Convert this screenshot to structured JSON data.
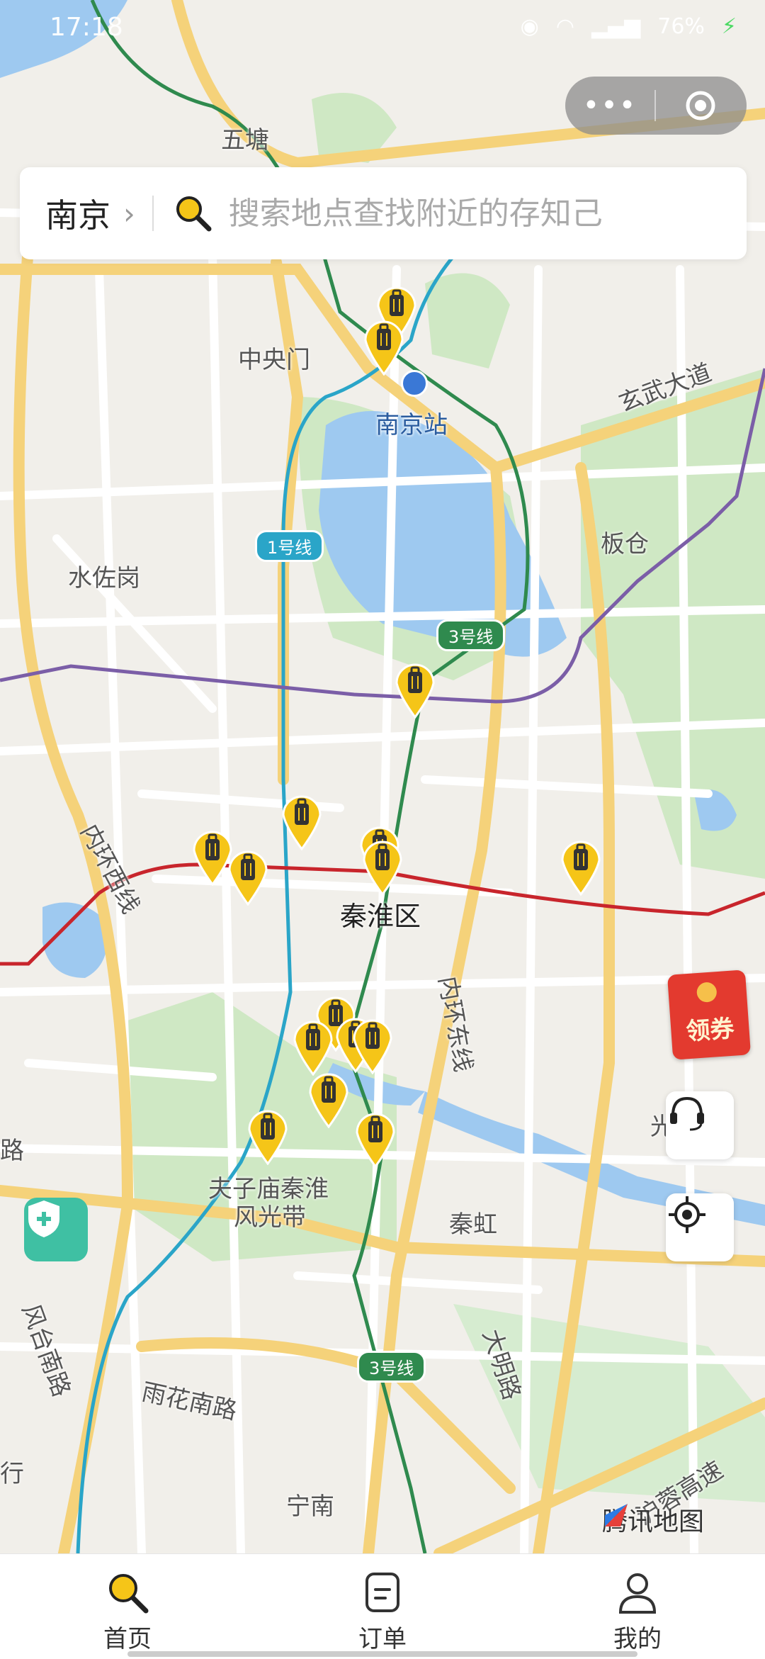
{
  "status_bar": {
    "time": "17:18",
    "battery": "76%"
  },
  "search": {
    "city": "南京",
    "placeholder": "搜索地点查找附近的存知己"
  },
  "map_labels": {
    "wutang": "五塘",
    "zhongyangmen": "中央门",
    "nanjing_station": "南京站",
    "xuanwu_avenue": "玄武大道",
    "bancang": "板仓",
    "shuizuogang": "水佐岗",
    "inner_ring_west": "内环西线",
    "qinhuai_district": "秦淮区",
    "inner_ring_east": "内环东线",
    "fuzimiao": "夫子庙秦淮",
    "fuzimiao2": "风光带",
    "qinhong": "秦虹",
    "daming_road": "大明路",
    "yuhua_south_road": "雨花南路",
    "ningnan": "宁南",
    "hunan_expressway": "沪蓉高速",
    "fengtai_south": "风台南路",
    "guang": "光",
    "lu": "路",
    "xing": "行"
  },
  "line_badges": {
    "line1": "1号线",
    "line3_top": "3号线",
    "line3_bottom": "3号线"
  },
  "coupon": {
    "label": "领券"
  },
  "map_brand": "腾讯地图",
  "tabs": [
    {
      "label": "首页",
      "icon": "search-icon"
    },
    {
      "label": "订单",
      "icon": "order-icon"
    },
    {
      "label": "我的",
      "icon": "user-icon"
    }
  ],
  "colors": {
    "accent": "#f5c518",
    "line1": "#2aa5c8",
    "line2": "#c8252c",
    "line3": "#2f8a4e",
    "line4": "#7b5ea7"
  }
}
